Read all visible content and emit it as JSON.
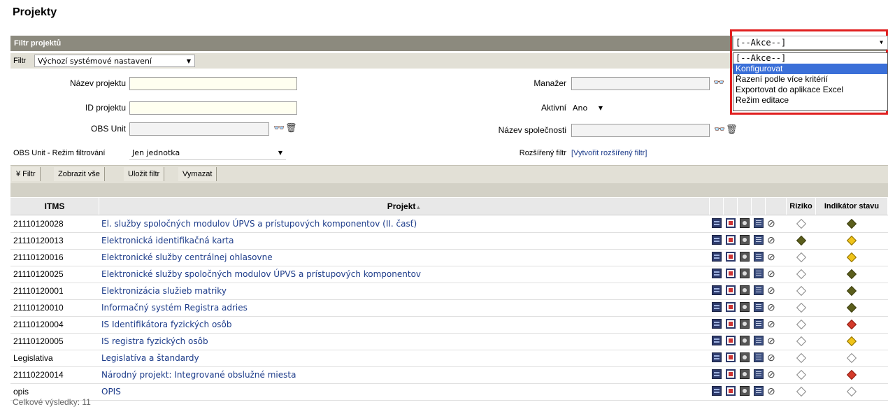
{
  "page": {
    "title": "Projekty"
  },
  "filter": {
    "header": "Filtr projektů",
    "filter_label": "Filtr",
    "filter_value": "Výchozí systémové nastavení",
    "fields": {
      "nazev_projektu": "Název projektu",
      "id_projektu": "ID projektu",
      "obs_unit": "OBS Unit",
      "obs_mode_label": "OBS Unit - Režim filtrování",
      "obs_mode_value": "Jen jednotka",
      "manazer": "Manažer",
      "aktivni": "Aktivní",
      "aktivni_value": "Ano",
      "nazev_spolecnosti": "Název společnosti",
      "rozsireny": "Rozšířený filtr",
      "rozsireny_link": "[Vytvořit rozšířený filtr]"
    }
  },
  "toolbar": {
    "filtr": "¥ Filtr",
    "zobrazit": "Zobrazit vše",
    "ulozit": "Uložit filtr",
    "vymazat": "Vymazat"
  },
  "actions": {
    "selected": "[--Akce--]",
    "options": [
      "[--Akce--]",
      "Konfigurovat",
      "Řazení podle více kritérií",
      "Exportovat do aplikace Excel",
      "Režim editace"
    ],
    "highlighted_index": 1
  },
  "table": {
    "columns": {
      "itms": "ITMS",
      "projekt": "Projekt",
      "riziko": "Riziko",
      "indikator": "Indikátor stavu"
    },
    "rows": [
      {
        "itms": "21110120028",
        "projekt": "El. služby spoločných modulov ÚPVS a prístupových komponentov (II. časť)",
        "riziko": "white",
        "indikator": "olive"
      },
      {
        "itms": "21110120013",
        "projekt": "Elektronická identifikačná karta",
        "riziko": "olive",
        "indikator": "yellow"
      },
      {
        "itms": "21110120016",
        "projekt": "Elektronické služby centrálnej ohlasovne",
        "riziko": "white",
        "indikator": "yellow"
      },
      {
        "itms": "21110120025",
        "projekt": "Elektronické služby spoločných modulov ÚPVS a prístupových komponentov",
        "riziko": "white",
        "indikator": "olive"
      },
      {
        "itms": "21110120001",
        "projekt": "Elektronizácia služieb matriky",
        "riziko": "white",
        "indikator": "olive"
      },
      {
        "itms": "21110120010",
        "projekt": "Informačný systém Registra adries",
        "riziko": "white",
        "indikator": "olive"
      },
      {
        "itms": "21110120004",
        "projekt": "IS Identifikátora fyzických osôb",
        "riziko": "white",
        "indikator": "red"
      },
      {
        "itms": "21110120005",
        "projekt": "IS registra fyzických osôb",
        "riziko": "white",
        "indikator": "yellow"
      },
      {
        "itms": "Legislativa",
        "projekt": "Legislatíva a štandardy",
        "riziko": "white",
        "indikator": "white"
      },
      {
        "itms": "21110220014",
        "projekt": "Národný projekt: Integrované obslužné miesta",
        "riziko": "white",
        "indikator": "red"
      },
      {
        "itms": "opis",
        "projekt": "OPIS",
        "riziko": "white",
        "indikator": "white"
      }
    ]
  },
  "footer": {
    "total": "Celkové výsledky: 11"
  }
}
